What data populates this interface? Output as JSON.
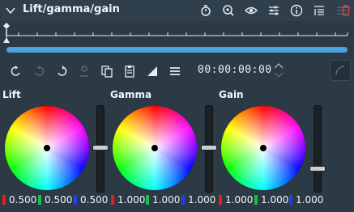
{
  "title": "Lift/gamma/gain",
  "header_icons": [
    "collapse-chevron-icon",
    "timer-icon",
    "zoom-icon",
    "eye-icon",
    "settings-sliders-icon",
    "info-icon",
    "sort-icon",
    "list-disabled-icon",
    "trash-icon"
  ],
  "toolbar": {
    "timecode": "00:00:00:00",
    "icons": [
      "undo-keyframe-icon",
      "redo-keyframe-icon",
      "next-keyframe-icon",
      "user-disabled-icon",
      "copy-icon",
      "paste-icon",
      "ramp-icon",
      "menu-icon"
    ]
  },
  "colors": {
    "accent": "#4aa3df",
    "bg": "#2b3a45",
    "red": "#e0201a",
    "green": "#18c048",
    "blue": "#2040e8"
  },
  "wheels": [
    {
      "label": "Lift",
      "r": "0.500",
      "g": "0.500",
      "b": "0.500",
      "level": 0.5
    },
    {
      "label": "Gamma",
      "r": "1.000",
      "g": "1.000",
      "b": "1.000",
      "level": 0.5
    },
    {
      "label": "Gain",
      "r": "1.000",
      "g": "1.000",
      "b": "1.000",
      "level": 0.25
    }
  ]
}
